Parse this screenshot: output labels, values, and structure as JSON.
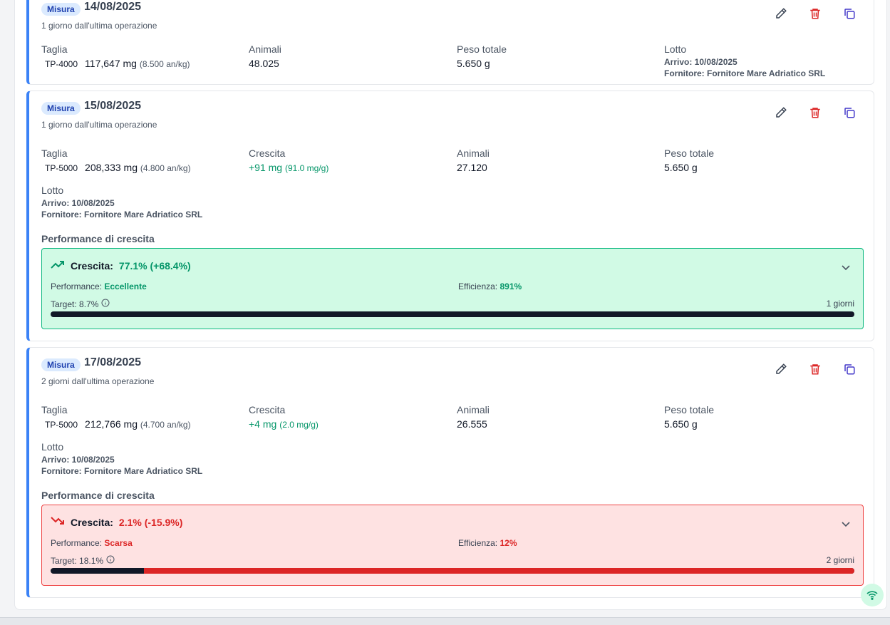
{
  "cards": [
    {
      "badge": "Misura",
      "date": "14/08/2025",
      "since": "1 giorno dall'ultima operazione",
      "taglia_label": "Taglia",
      "taglia_code": "TP-4000",
      "taglia_mg": "117,647 mg",
      "taglia_per_kg": "(8.500 an/kg)",
      "animali_label": "Animali",
      "animali": "48.025",
      "peso_label": "Peso totale",
      "peso": "5.650 g",
      "lotto_label": "Lotto",
      "arrivo": "Arrivo: 10/08/2025",
      "fornitore": "Fornitore: Fornitore Mare Adriatico SRL"
    },
    {
      "badge": "Misura",
      "date": "15/08/2025",
      "since": "1 giorno dall'ultima operazione",
      "taglia_label": "Taglia",
      "taglia_code": "TP-5000",
      "taglia_mg": "208,333 mg",
      "taglia_per_kg": "(4.800 an/kg)",
      "crescita_label": "Crescita",
      "crescita": "+91 mg",
      "crescita_rate": "(91.0 mg/g)",
      "animali_label": "Animali",
      "animali": "27.120",
      "peso_label": "Peso totale",
      "peso": "5.650 g",
      "lotto_label": "Lotto",
      "arrivo": "Arrivo: 10/08/2025",
      "fornitore": "Fornitore: Fornitore Mare Adriatico SRL",
      "perf_title": "Performance di crescita",
      "perf": {
        "label": "Crescita:",
        "value": "77.1% (+68.4%)",
        "performance_label": "Performance:",
        "performance": "Eccellente",
        "efficienza_label": "Efficienza:",
        "efficienza": "891%",
        "target": "Target: 8.7%",
        "days": "1 giorni",
        "progress_fraction": 1.0
      }
    },
    {
      "badge": "Misura",
      "date": "17/08/2025",
      "since": "2 giorni dall'ultima operazione",
      "taglia_label": "Taglia",
      "taglia_code": "TP-5000",
      "taglia_mg": "212,766 mg",
      "taglia_per_kg": "(4.700 an/kg)",
      "crescita_label": "Crescita",
      "crescita": "+4 mg",
      "crescita_rate": "(2.0 mg/g)",
      "animali_label": "Animali",
      "animali": "26.555",
      "peso_label": "Peso totale",
      "peso": "5.650 g",
      "lotto_label": "Lotto",
      "arrivo": "Arrivo: 10/08/2025",
      "fornitore": "Fornitore: Fornitore Mare Adriatico SRL",
      "perf_title": "Performance di crescita",
      "perf": {
        "label": "Crescita:",
        "value": "2.1% (-15.9%)",
        "performance_label": "Performance:",
        "performance": "Scarsa",
        "efficienza_label": "Efficienza:",
        "efficienza": "12%",
        "target": "Target: 18.1%",
        "days": "2 giorni",
        "progress_fraction": 0.116
      }
    }
  ],
  "colors": {
    "accent": "#3b82f6",
    "good": "#059669",
    "bad": "#dc2626",
    "bar_dark": "#111827"
  }
}
